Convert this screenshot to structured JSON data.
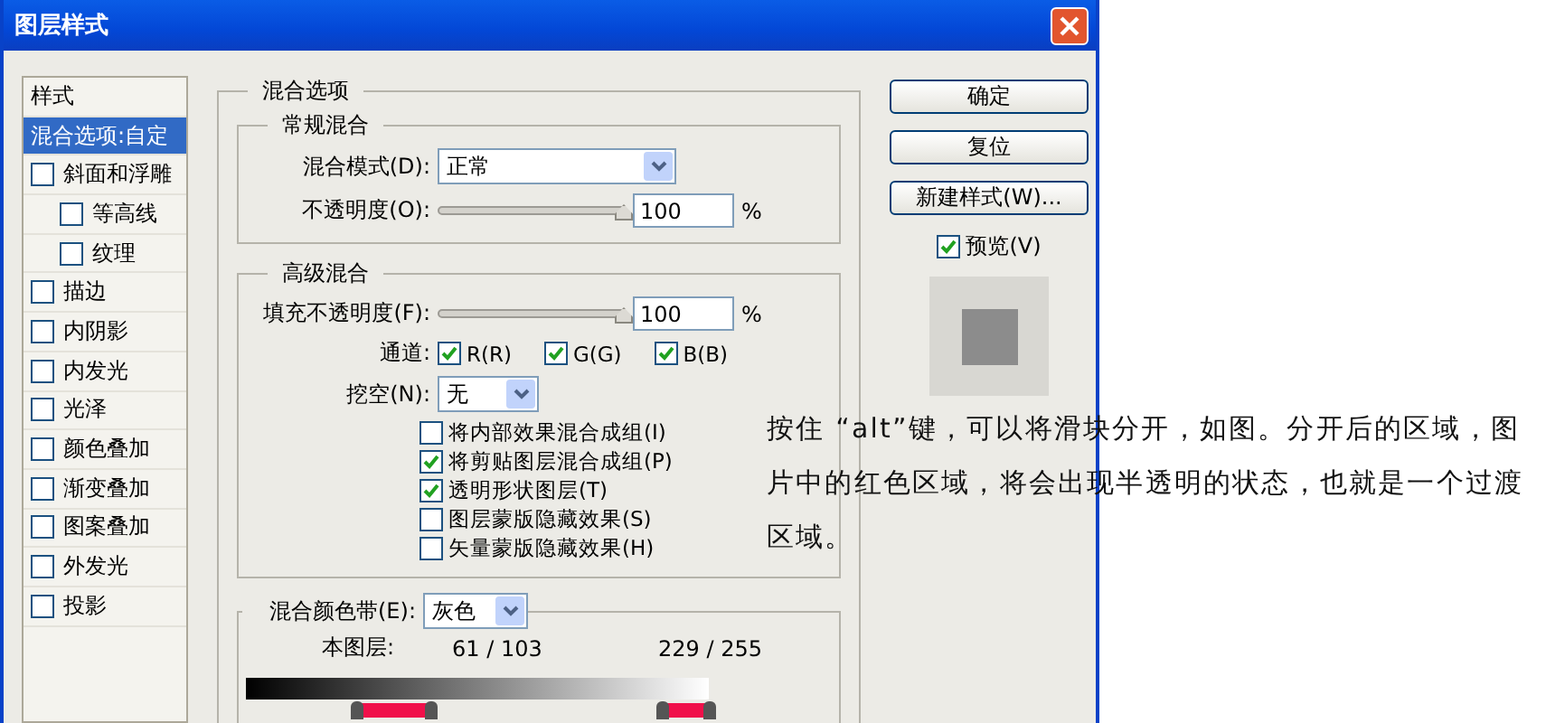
{
  "window": {
    "title": "图层样式"
  },
  "styles_list": [
    {
      "kind": "header",
      "label": "样式"
    },
    {
      "kind": "option",
      "label": "混合选项:自定",
      "selected": true
    },
    {
      "kind": "effect",
      "label": "斜面和浮雕",
      "checked": false,
      "selected": false,
      "children": [
        {
          "kind": "effect",
          "label": "等高线",
          "checked": false,
          "selected": false
        },
        {
          "kind": "effect",
          "label": "纹理",
          "checked": false,
          "selected": false
        }
      ]
    },
    {
      "kind": "effect",
      "label": "描边",
      "checked": false,
      "selected": false
    },
    {
      "kind": "effect",
      "label": "内阴影",
      "checked": false,
      "selected": false
    },
    {
      "kind": "effect",
      "label": "内发光",
      "checked": false,
      "selected": false
    },
    {
      "kind": "effect",
      "label": "光泽",
      "checked": false,
      "selected": false
    },
    {
      "kind": "effect",
      "label": "颜色叠加",
      "checked": false,
      "selected": false
    },
    {
      "kind": "effect",
      "label": "渐变叠加",
      "checked": false,
      "selected": false
    },
    {
      "kind": "effect",
      "label": "图案叠加",
      "checked": false,
      "selected": false
    },
    {
      "kind": "effect",
      "label": "外发光",
      "checked": false,
      "selected": false
    },
    {
      "kind": "effect",
      "label": "投影",
      "checked": false,
      "selected": false
    }
  ],
  "blending_options": {
    "title": "混合选项",
    "general": {
      "title": "常规混合",
      "blend_mode": {
        "label": "混合模式(D):",
        "value": "正常"
      },
      "opacity": {
        "label": "不透明度(O):",
        "level": 1,
        "value": "100",
        "unit": "%"
      }
    },
    "advanced": {
      "title": "高级混合",
      "fill_opacity": {
        "label": "填充不透明度(F):",
        "level": 1,
        "value": "100",
        "unit": "%"
      },
      "channels": {
        "label": "通道:",
        "items": [
          {
            "label": "R(R)",
            "checked": true
          },
          {
            "label": "G(G)",
            "checked": true
          },
          {
            "label": "B(B)",
            "checked": true
          }
        ]
      },
      "knockout": {
        "label": "挖空(N):",
        "value": "无"
      },
      "options": [
        {
          "label": "将内部效果混合成组(I)",
          "checked": false
        },
        {
          "label": "将剪贴图层混合成组(P)",
          "checked": true
        },
        {
          "label": "透明形状图层(T)",
          "checked": true
        },
        {
          "label": "图层蒙版隐藏效果(S)",
          "checked": false
        },
        {
          "label": "矢量蒙版隐藏效果(H)",
          "checked": false
        }
      ]
    },
    "blend_if": {
      "label": "混合颜色带(E):",
      "value": "灰色",
      "this_layer": {
        "label": "本图层:",
        "low": "61 / 103",
        "high": "229 / 255",
        "thumbs": [
          {
            "level": 0.24
          },
          {
            "level": 0.4
          },
          {
            "level": 0.9
          },
          {
            "level": 1
          }
        ]
      }
    }
  },
  "buttons": [
    "确定",
    "复位",
    "新建样式(W)..."
  ],
  "preview": {
    "label": "预览(V)",
    "checked": true
  },
  "annotation": "按住 “alt”键，可以将滑块分开，如图。分开后的区域，图片中的红色区域，将会出现半透明的状态，也就是一个过渡区域。"
}
